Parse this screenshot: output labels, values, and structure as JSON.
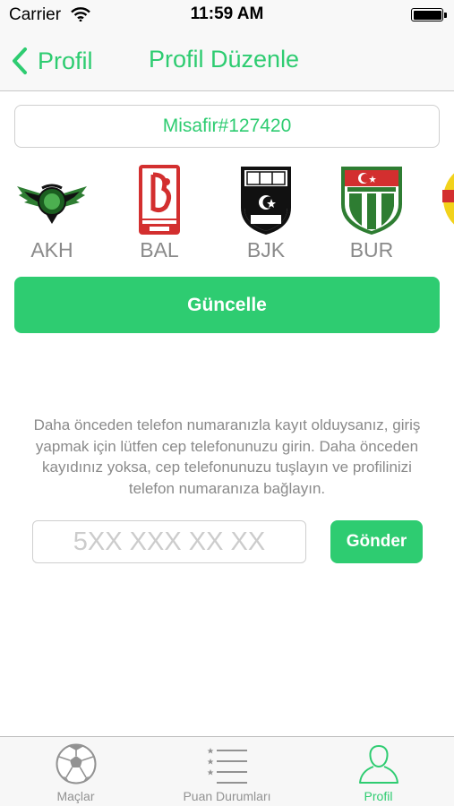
{
  "status_bar": {
    "carrier": "Carrier",
    "time": "11:59 AM"
  },
  "nav": {
    "back_label": "Profil",
    "title": "Profil Düzenle"
  },
  "profile": {
    "username": "Misafir#127420"
  },
  "teams": [
    {
      "code": "AKH",
      "icon": "akhisar-crest-icon"
    },
    {
      "code": "BAL",
      "icon": "balikesirspor-crest-icon"
    },
    {
      "code": "BJK",
      "icon": "besiktas-crest-icon"
    },
    {
      "code": "BUR",
      "icon": "bursaspor-crest-icon"
    },
    {
      "code": "",
      "icon": "yellow-crest-icon"
    }
  ],
  "update_button": {
    "label": "Güncelle"
  },
  "info_text": "Daha önceden telefon numaranızla kayıt olduysanız, giriş yapmak için lütfen cep telefonunuzu girin. Daha önceden kayıdınız yoksa, cep telefonunuzu tuşlayın ve profilinizi telefon numaranıza bağlayın.",
  "phone": {
    "placeholder": "5XX XXX XX XX",
    "value": ""
  },
  "send_button": {
    "label": "Gönder"
  },
  "tab_bar": {
    "tabs": [
      {
        "label": "Maçlar",
        "icon": "soccer-ball-icon",
        "active": false
      },
      {
        "label": "Puan Durumları",
        "icon": "standings-list-icon",
        "active": false
      },
      {
        "label": "Profil",
        "icon": "profile-person-icon",
        "active": true
      }
    ]
  },
  "colors": {
    "accent": "#2ecc71",
    "muted_text": "#8a8a8a",
    "bar_background": "#f8f8f8"
  }
}
